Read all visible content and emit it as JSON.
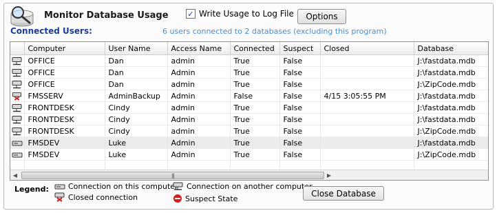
{
  "header": {
    "title": "Monitor Database Usage",
    "write_usage_label": "Write Usage to Log File",
    "write_usage_checked": true,
    "options_label": "Options"
  },
  "connected": {
    "label": "Connected Users:",
    "status": "6 users connected to 2 databases (excluding this program)"
  },
  "table": {
    "columns": [
      "Computer",
      "User Name",
      "Access Name",
      "Connected",
      "Suspect",
      "Closed",
      "Database"
    ],
    "rows": [
      {
        "icon": "network-computer",
        "computer": "OFFICE",
        "user": "Dan",
        "access": "admin",
        "connected": "True",
        "suspect": "False",
        "closed": "",
        "database": "J:\\fastdata.mdb"
      },
      {
        "icon": "network-computer",
        "computer": "OFFICE",
        "user": "Dan",
        "access": "Admin",
        "connected": "True",
        "suspect": "False",
        "closed": "",
        "database": "J:\\fastdata.mdb"
      },
      {
        "icon": "network-computer",
        "computer": "OFFICE",
        "user": "Dan",
        "access": "admin",
        "connected": "True",
        "suspect": "False",
        "closed": "",
        "database": "J:\\ZipCode.mdb"
      },
      {
        "icon": "closed-connection",
        "computer": "FMSSERV",
        "user": "AdminBackup",
        "access": "Admin",
        "connected": "False",
        "suspect": "False",
        "closed": "4/15  3:05:55 PM",
        "database": "J:\\fastdata.mdb"
      },
      {
        "icon": "network-computer",
        "computer": "FRONTDESK",
        "user": "Cindy",
        "access": "admin",
        "connected": "True",
        "suspect": "False",
        "closed": "",
        "database": "J:\\fastdata.mdb"
      },
      {
        "icon": "network-computer",
        "computer": "FRONTDESK",
        "user": "Cindy",
        "access": "Admin",
        "connected": "True",
        "suspect": "False",
        "closed": "",
        "database": "J:\\fastdata.mdb"
      },
      {
        "icon": "network-computer",
        "computer": "FRONTDESK",
        "user": "Cindy",
        "access": "admin",
        "connected": "True",
        "suspect": "False",
        "closed": "",
        "database": "J:\\ZipCode.mdb"
      },
      {
        "icon": "local-computer",
        "computer": "FMSDEV",
        "user": "Luke",
        "access": "Admin",
        "connected": "True",
        "suspect": "False",
        "closed": "",
        "database": "J:\\fastdata.mdb"
      },
      {
        "icon": "local-computer",
        "computer": "FMSDEV",
        "user": "Luke",
        "access": "Admin",
        "connected": "True",
        "suspect": "False",
        "closed": "",
        "database": "J:\\ZipCode.mdb"
      }
    ],
    "highlight_row": 7
  },
  "legend": {
    "label": "Legend:",
    "items": {
      "this_computer": "Connection on this computer",
      "another_computer": "Connection on another computer",
      "closed": "Closed connection",
      "suspect": "Suspect State"
    }
  },
  "close_database_label": "Close Database",
  "colors": {
    "accent_blue": "#1a3c9b",
    "status_blue": "#4a8ed0",
    "suspect_red": "#d42020"
  }
}
